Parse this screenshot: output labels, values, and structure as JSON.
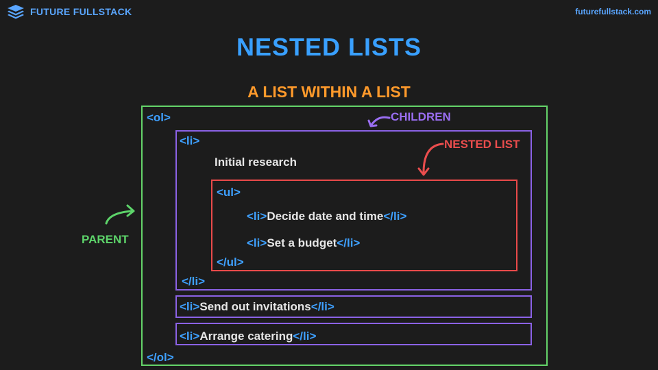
{
  "brand": {
    "name": "FUTURE FULLSTACK",
    "site": "futurefullstack.com"
  },
  "title": "NESTED LISTS",
  "subtitle": "A LIST WITHIN A LIST",
  "labels": {
    "children": "CHILDREN",
    "nested_list": "NESTED LIST",
    "parent": "PARENT"
  },
  "code": {
    "ol_open": "<ol>",
    "li_open": "<li>",
    "li1_text": "Initial research",
    "ul_open": "<ul>",
    "li_a_open": "<li>",
    "li_a_text": "Decide date and time",
    "li_a_close": "</li>",
    "li_b_open": "<li>",
    "li_b_text": "Set a budget",
    "li_b_close": "</li>",
    "ul_close": "</ul>",
    "li_close": "</li>",
    "li2_open": "<li>",
    "li2_text": "Send out invitations",
    "li2_close": "</li>",
    "li3_open": "<li>",
    "li3_text": "Arrange catering",
    "li3_close": "</li>",
    "ol_close": "</ol>"
  },
  "colors": {
    "background": "#1c1c1c",
    "title": "#39a0ff",
    "subtitle": "#ff9a2b",
    "parent": "#64d46a",
    "children": "#8b62e6",
    "nested_list": "#ea4a4a",
    "tag": "#3ea0ff"
  },
  "icons": [
    "stack-layers-icon",
    "curved-arrow-icon"
  ]
}
